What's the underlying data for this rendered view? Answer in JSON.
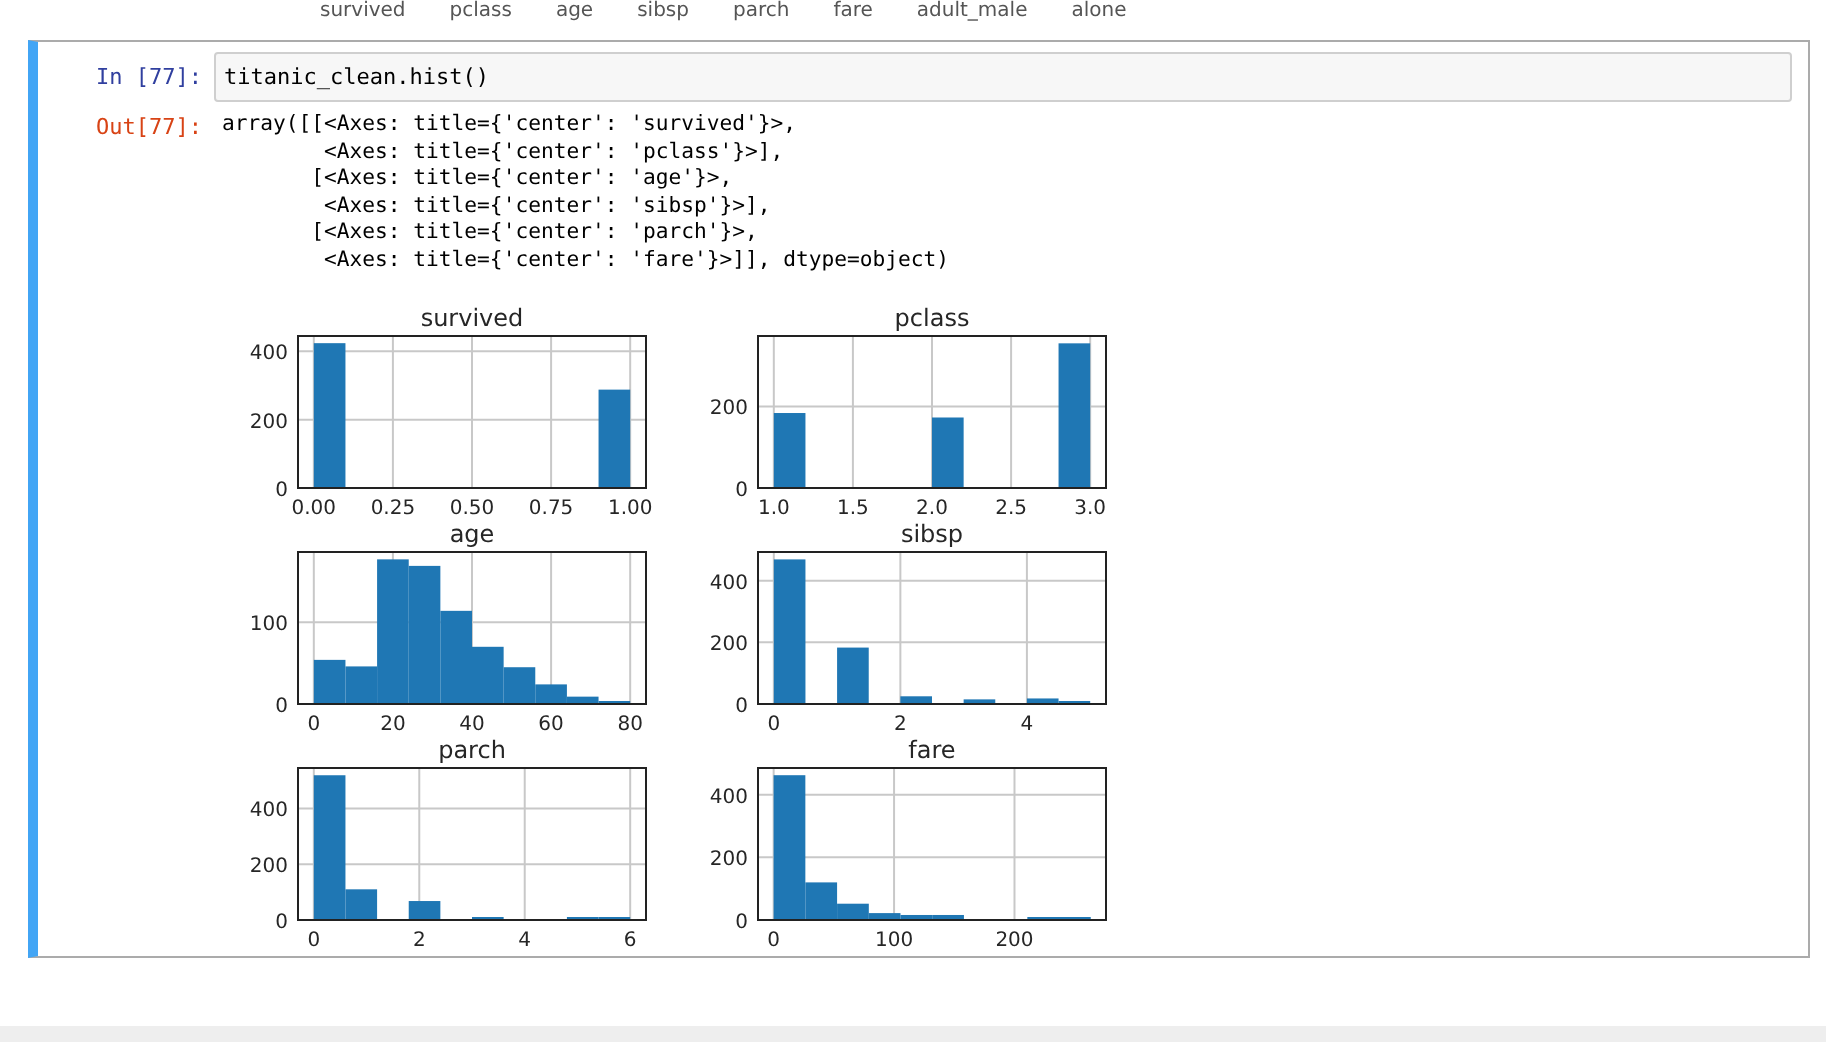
{
  "previous_output": {
    "column_headers": [
      "survived",
      "pclass",
      "age",
      "sibsp",
      "parch",
      "fare",
      "adult_male",
      "alone"
    ]
  },
  "cell": {
    "input_prompt": "In [77]:",
    "code": "titanic_clean.hist()",
    "output_prompt": "Out[77]:",
    "output_lines": [
      "array([[<Axes: title={'center': 'survived'}>,",
      "        <Axes: title={'center': 'pclass'}>],",
      "       [<Axes: title={'center': 'age'}>,",
      "        <Axes: title={'center': 'sibsp'}>],",
      "       [<Axes: title={'center': 'parch'}>,",
      "        <Axes: title={'center': 'fare'}>]], dtype=object)"
    ],
    "charts": [
      {
        "chart_data": {
          "type": "bar",
          "title": "survived",
          "grid": true,
          "x": [
            0.05,
            0.15,
            0.25,
            0.35,
            0.45,
            0.55,
            0.65,
            0.75,
            0.85,
            0.95
          ],
          "values": [
            424,
            0,
            0,
            0,
            0,
            0,
            0,
            0,
            0,
            288
          ],
          "xlim": [
            -0.05,
            1.05
          ],
          "ylim": [
            0,
            445
          ],
          "xticks": [
            {
              "value": 0,
              "label": "0.00"
            },
            {
              "value": 0.25,
              "label": "0.25"
            },
            {
              "value": 0.5,
              "label": "0.50"
            },
            {
              "value": 0.75,
              "label": "0.75"
            },
            {
              "value": 1,
              "label": "1.00"
            }
          ],
          "yticks": [
            0,
            200,
            400
          ]
        }
      },
      {
        "chart_data": {
          "type": "bar",
          "title": "pclass",
          "grid": true,
          "x": [
            1.1,
            1.3,
            1.5,
            1.7,
            1.9,
            2.1,
            2.3,
            2.5,
            2.7,
            2.9
          ],
          "values": [
            184,
            0,
            0,
            0,
            0,
            173,
            0,
            0,
            0,
            355
          ],
          "xlim": [
            0.9,
            3.1
          ],
          "ylim": [
            0,
            373
          ],
          "xticks": [
            {
              "value": 1,
              "label": "1.0"
            },
            {
              "value": 1.5,
              "label": "1.5"
            },
            {
              "value": 2,
              "label": "2.0"
            },
            {
              "value": 2.5,
              "label": "2.5"
            },
            {
              "value": 3,
              "label": "3.0"
            }
          ],
          "yticks": [
            0,
            200
          ]
        }
      },
      {
        "chart_data": {
          "type": "bar",
          "title": "age",
          "grid": true,
          "x": [
            4,
            12,
            20,
            28,
            36,
            44,
            52,
            60,
            68,
            76
          ],
          "values": [
            54,
            46,
            177,
            169,
            114,
            70,
            45,
            24,
            9,
            2
          ],
          "xlim": [
            -4,
            84
          ],
          "ylim": [
            0,
            186
          ],
          "xticks": [
            0,
            20,
            40,
            60,
            80
          ],
          "yticks": [
            0,
            100
          ]
        }
      },
      {
        "chart_data": {
          "type": "bar",
          "title": "sibsp",
          "grid": true,
          "x": [
            0.25,
            0.75,
            1.25,
            1.75,
            2.25,
            2.75,
            3.25,
            3.75,
            4.25,
            4.75
          ],
          "values": [
            469,
            0,
            183,
            0,
            25,
            0,
            15,
            0,
            18,
            5
          ],
          "xlim": [
            -0.25,
            5.25
          ],
          "ylim": [
            0,
            493
          ],
          "xticks": [
            0,
            2,
            4
          ],
          "yticks": [
            0,
            200,
            400
          ]
        }
      },
      {
        "chart_data": {
          "type": "bar",
          "title": "parch",
          "grid": true,
          "x": [
            0.3,
            0.9,
            1.5,
            2.1,
            2.7,
            3.3,
            3.9,
            4.5,
            5.1,
            5.7
          ],
          "values": [
            519,
            110,
            0,
            68,
            0,
            5,
            0,
            0,
            5,
            2
          ],
          "xlim": [
            -0.3,
            6.3
          ],
          "ylim": [
            0,
            545
          ],
          "xticks": [
            0,
            2,
            4,
            6
          ],
          "yticks": [
            0,
            200,
            400
          ]
        }
      },
      {
        "chart_data": {
          "type": "bar",
          "title": "fare",
          "grid": true,
          "x": [
            13.15,
            39.5,
            65.85,
            92.15,
            118.5,
            144.85,
            171.15,
            197.5,
            223.85,
            250.15
          ],
          "values": [
            462,
            120,
            52,
            22,
            16,
            16,
            0,
            0,
            4,
            4
          ],
          "xlim": [
            -13,
            276
          ],
          "ylim": [
            0,
            485
          ],
          "xticks": [
            0,
            100,
            200
          ],
          "yticks": [
            0,
            200,
            400
          ]
        }
      }
    ]
  }
}
